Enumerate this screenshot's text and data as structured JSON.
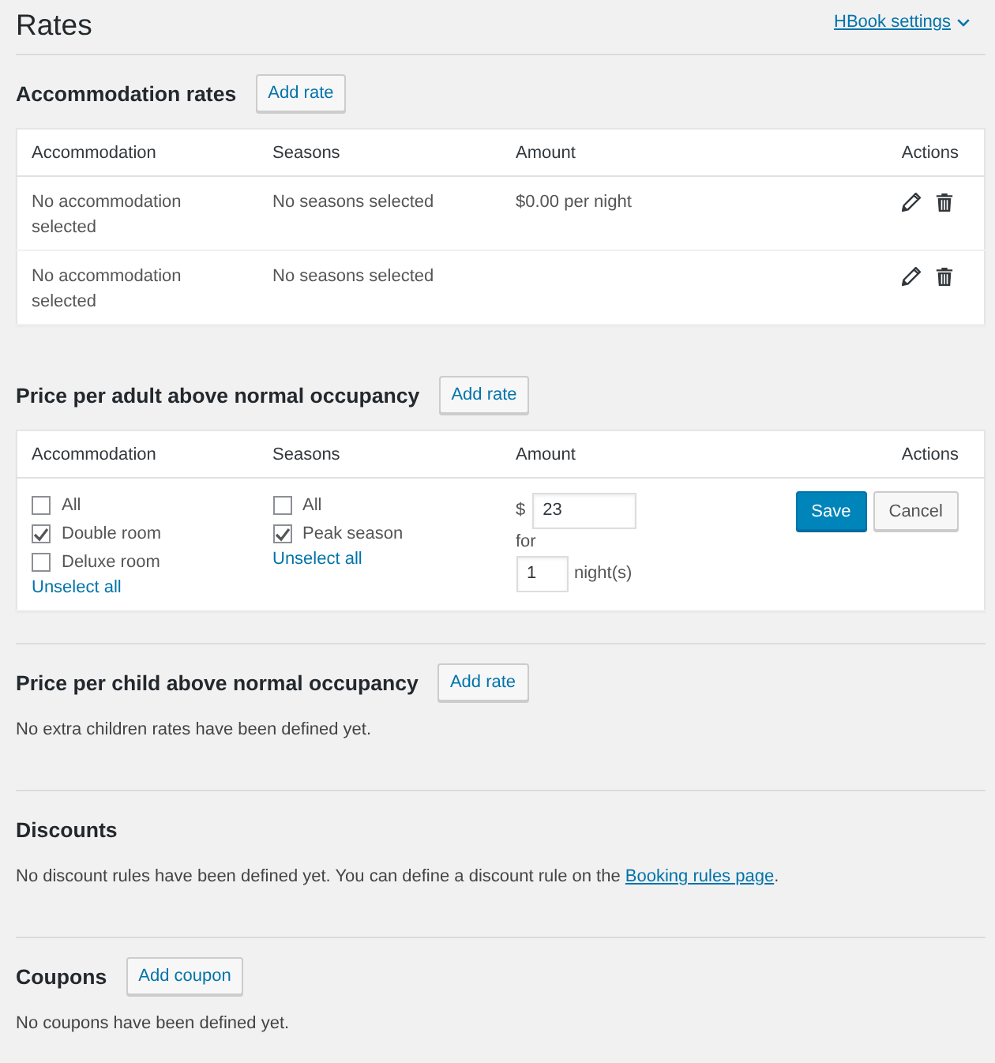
{
  "header": {
    "title": "Rates",
    "settings_link": "HBook settings"
  },
  "sections": [
    {
      "kind": "table",
      "heading": "Accommodation rates",
      "button": "Add rate",
      "columns": [
        "Accommodation",
        "Seasons",
        "Amount",
        "Actions"
      ],
      "rows": [
        {
          "kind": "view",
          "accommodation": "No accommodation selected",
          "seasons": "No seasons selected",
          "amount": "$0.00 per night"
        },
        {
          "kind": "view",
          "accommodation": "No accommodation selected",
          "seasons": "No seasons selected"
        }
      ]
    },
    {
      "kind": "table",
      "heading": "Price per adult above normal occupancy",
      "button": "Add rate",
      "columns": [
        "Accommodation",
        "Seasons",
        "Amount",
        "Actions"
      ],
      "rows": [
        {
          "kind": "edit",
          "accommodations": {
            "options": [
              {
                "label": "All",
                "checked": false
              },
              {
                "label": "Double room",
                "checked": true
              },
              {
                "label": "Deluxe room",
                "checked": false
              }
            ],
            "unselect": "Unselect all"
          },
          "seasons": {
            "options": [
              {
                "label": "All",
                "checked": false
              },
              {
                "label": "Peak season",
                "checked": true
              }
            ],
            "unselect": "Unselect all"
          },
          "amount": {
            "currency": "$",
            "value": "23",
            "for": "for",
            "nights": "1",
            "unit": "night(s)"
          },
          "buttons": {
            "save": "Save",
            "cancel": "Cancel"
          }
        }
      ]
    },
    {
      "kind": "message",
      "heading": "Price per child above normal occupancy",
      "button": "Add rate",
      "message": "No extra children rates have been defined yet."
    },
    {
      "kind": "message",
      "heading": "Discounts",
      "message": "No discount rules have been defined yet. You can define a discount rule on the",
      "link": "Booking rules page",
      "message_end": "."
    },
    {
      "kind": "message",
      "heading": "Coupons",
      "button": "Add coupon",
      "message": "No coupons have been defined yet."
    }
  ]
}
